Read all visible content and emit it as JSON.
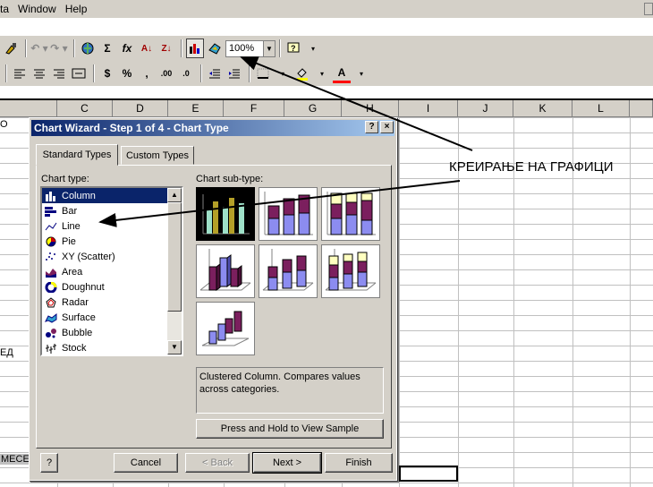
{
  "menu": {
    "items": [
      "ta",
      "Window",
      "Help"
    ]
  },
  "toolbar1": {
    "zoom_value": "100%",
    "function_label": "fx",
    "sum_label": "Σ",
    "sort_asc_label": "A↓",
    "sort_desc_label": "Z↓"
  },
  "toolbar2": {
    "currency_label": "$",
    "percent_label": "%",
    "font_color_label": "A"
  },
  "columns": [
    "C",
    "D",
    "E",
    "F",
    "G",
    "H",
    "I",
    "J",
    "K",
    "L"
  ],
  "cells": {
    "row1_left": "O",
    "row16_left": "ЕД",
    "row23_left": "МЕСЕ"
  },
  "annotation": "КРЕИРАЊЕ НА ГРАФИЦИ",
  "dialog": {
    "title": "Chart Wizard - Step 1 of 4 - Chart Type",
    "help_button": "?",
    "close_button": "×",
    "tabs": [
      "Standard Types",
      "Custom Types"
    ],
    "chart_type_label": "Chart type:",
    "chart_subtype_label": "Chart sub-type:",
    "chart_types": [
      "Column",
      "Bar",
      "Line",
      "Pie",
      "XY (Scatter)",
      "Area",
      "Doughnut",
      "Radar",
      "Surface",
      "Bubble",
      "Stock"
    ],
    "selected_type": "Column",
    "description": "Clustered Column. Compares values across categories.",
    "sample_button": "Press and Hold to View Sample",
    "office_assistant_button": "?",
    "buttons": {
      "cancel": "Cancel",
      "back": "< Back",
      "next": "Next >",
      "finish": "Finish"
    }
  },
  "colors": {
    "title_bar": "#0a246a",
    "selection": "#0a246a",
    "series_purple": "#7b1f5e",
    "series_blue": "#8c8cf0",
    "series_yellow": "#ffffc0",
    "series_teal": "#9ee0c8",
    "series_olive": "#b4a028"
  }
}
